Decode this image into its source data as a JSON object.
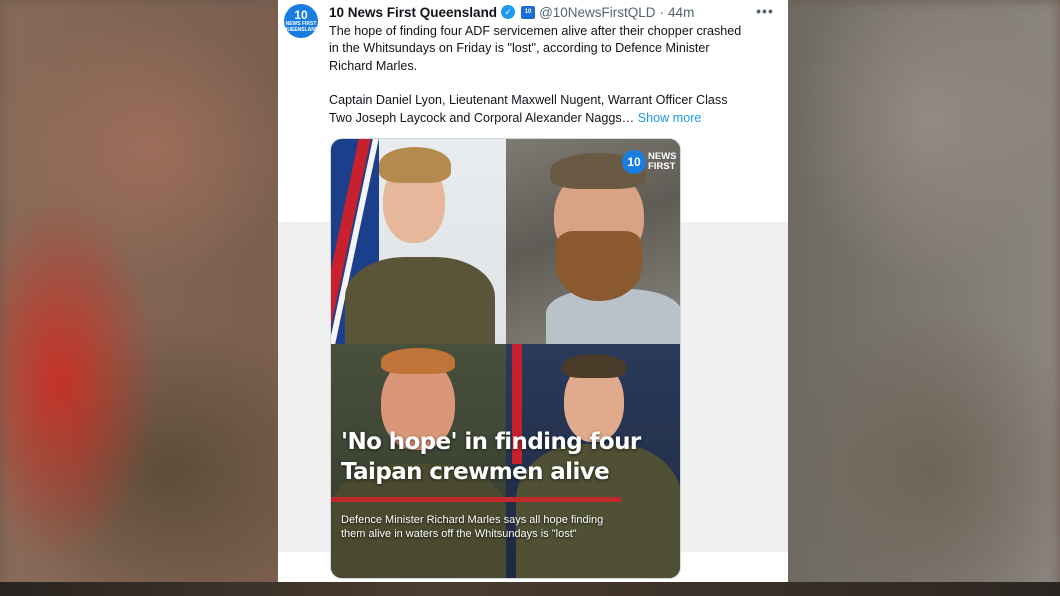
{
  "tweet": {
    "display_name": "10 News First Queensland",
    "handle": "@10NewsFirstQLD",
    "separator": "·",
    "time": "44m",
    "more_icon": "•••",
    "avatar": {
      "top": "10",
      "bottom": "NEWS FIRST",
      "sub": "QUEENSLAND"
    },
    "affiliate_badge": "10",
    "verified_icon": "✓",
    "text_para1": "The hope of finding four ADF servicemen alive after their chopper crashed\nin the Whitsundays on Friday is \"lost\", according to Defence Minister\nRichard Marles.",
    "text_para2": "Captain Daniel Lyon, Lieutenant Maxwell Nugent, Warrant Officer Class\nTwo Joseph Laycock and Corporal Alexander Naggs…",
    "show_more": "Show more"
  },
  "media": {
    "brand_number": "10",
    "brand_text": "NEWS\nFIRST",
    "headline": "'No hope' in finding four\nTaipan crewmen alive",
    "subhead": "Defence Minister Richard Marles says all hope finding\nthem alive in waters off the Whitsundays is \"lost\""
  },
  "colors": {
    "accent": "#1d9bf0",
    "brand_blue": "#1a7de0",
    "headline_bar": "#c0282c"
  }
}
